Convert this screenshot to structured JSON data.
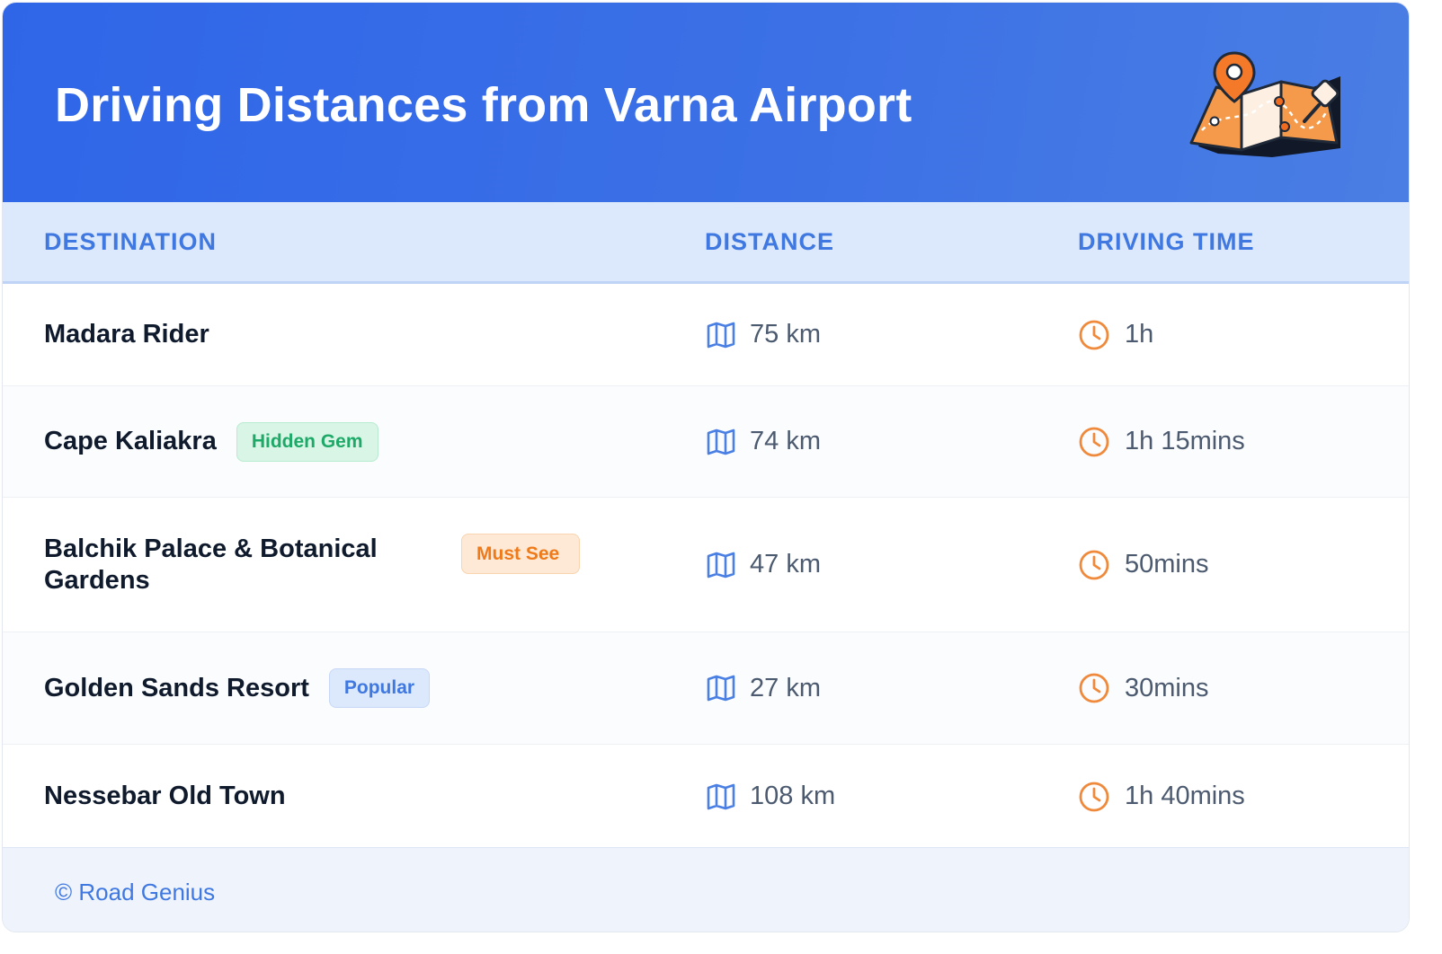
{
  "header": {
    "title": "Driving Distances from Varna Airport",
    "illustration_icon": "map-pin-illustration"
  },
  "table": {
    "columns": [
      "DESTINATION",
      "DISTANCE",
      "DRIVING TIME"
    ],
    "rows": [
      {
        "destination": "Madara Rider",
        "badge": null,
        "distance": "75 km",
        "time": "1h"
      },
      {
        "destination": "Cape Kaliakra",
        "badge": "Hidden Gem",
        "distance": "74 km",
        "time": "1h 15mins"
      },
      {
        "destination": "Balchik Palace & Botanical Gardens",
        "badge": "Must See",
        "distance": "47 km",
        "time": "50mins"
      },
      {
        "destination": "Golden Sands Resort",
        "badge": "Popular",
        "distance": "27 km",
        "time": "30mins"
      },
      {
        "destination": "Nessebar Old Town",
        "badge": null,
        "distance": "108 km",
        "time": "1h 40mins"
      }
    ],
    "distance_icon": "map-icon",
    "time_icon": "clock-icon"
  },
  "footer": {
    "credit": "© Road Genius"
  },
  "colors": {
    "header_blue": "#2f66e8",
    "accent_blue": "#3f78e0",
    "badge_green": "#1fa968",
    "badge_orange": "#ef7a1a",
    "clock_orange": "#ef8a3c"
  }
}
